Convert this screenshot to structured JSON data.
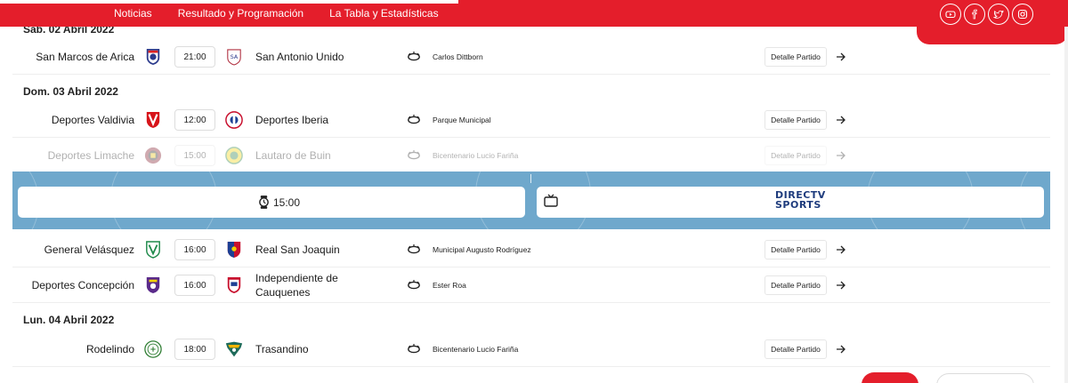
{
  "nav": {
    "items": [
      "Noticias",
      "Resultado y Programación",
      "La Tabla y Estadísticas"
    ]
  },
  "social": [
    {
      "name": "youtube-icon"
    },
    {
      "name": "facebook-icon"
    },
    {
      "name": "twitter-icon"
    },
    {
      "name": "instagram-icon"
    }
  ],
  "colors": {
    "brand_red": "#e41e2b",
    "broadcast_blue": "#6fa8cc",
    "directv_navy": "#1f3c7d"
  },
  "dates": {
    "d1": "Sab. 02 Abril 2022",
    "d2": "Dom. 03 Abril 2022",
    "d3": "Lun. 04 Abril 2022"
  },
  "detail_label": "Detalle Partido",
  "matches": [
    {
      "home": "San Marcos de Arica",
      "time": "21:00",
      "away": "San Antonio Unido",
      "stadium": "Carlos Dittborn"
    },
    {
      "home": "Deportes Valdivia",
      "time": "12:00",
      "away": "Deportes Iberia",
      "stadium": "Parque Municipal"
    },
    {
      "home": "Deportes Limache",
      "time": "15:00",
      "away": "Lautaro de Buin",
      "stadium": "Bicentenario Lucio Fariña"
    },
    {
      "home": "General Velásquez",
      "time": "16:00",
      "away": "Real San Joaquin",
      "stadium": "Municipal Augusto Rodríguez"
    },
    {
      "home": "Deportes Concepción",
      "time": "16:00",
      "away": "Independiente de Cauquenes",
      "stadium": "Ester Roa"
    },
    {
      "home": "Rodelindo",
      "time": "18:00",
      "away": "Trasandino",
      "stadium": "Bicentenario Lucio Fariña"
    }
  ],
  "broadcast": {
    "time": "15:00",
    "channel_line1": "DIRECTV",
    "channel_line2": "SPORTS"
  }
}
